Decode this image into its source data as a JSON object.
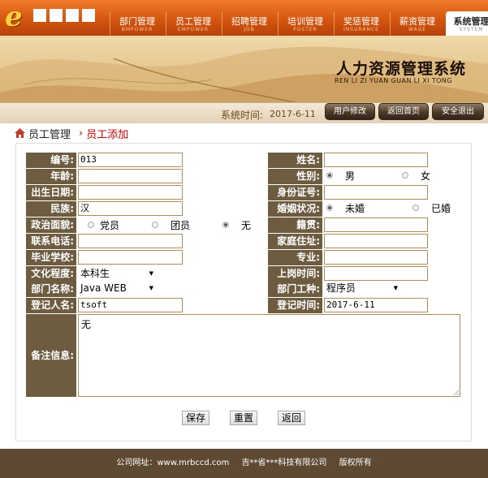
{
  "brand": {
    "logo_letter": "e",
    "name": ""
  },
  "nav": [
    {
      "zh": "部门管理",
      "en": "BMPOWER"
    },
    {
      "zh": "员工管理",
      "en": "EMPOWER"
    },
    {
      "zh": "招聘管理",
      "en": "JOB"
    },
    {
      "zh": "培训管理",
      "en": "FOSTER"
    },
    {
      "zh": "奖惩管理",
      "en": "INSURANCE"
    },
    {
      "zh": "薪资管理",
      "en": "WAGE"
    },
    {
      "zh": "系统管理",
      "en": "SYSTEM"
    }
  ],
  "header": {
    "system_title": "人力资源管理系统",
    "pinyin": "REN LI ZI YUAN GUAN LI XI TONG",
    "time_label": "系统时间:",
    "time_value": "2017-6-11",
    "buttons": [
      "用户修改",
      "返回首页",
      "安全退出"
    ]
  },
  "breadcrumb": {
    "current": "员工管理",
    "sub": "员工添加"
  },
  "form": {
    "number": {
      "label": "编号:",
      "value": "013"
    },
    "name": {
      "label": "姓名:",
      "value": ""
    },
    "age": {
      "label": "年龄:",
      "value": ""
    },
    "gender": {
      "label": "性别:",
      "options": [
        "男",
        "女"
      ],
      "selected": "男"
    },
    "birthday": {
      "label": "出生日期:",
      "value": ""
    },
    "id_card": {
      "label": "身份证号:",
      "value": ""
    },
    "nation": {
      "label": "民族:",
      "value": "汉"
    },
    "marriage": {
      "label": "婚姻状况:",
      "options": [
        "未婚",
        "已婚"
      ],
      "selected": "未婚"
    },
    "politics": {
      "label": "政治面貌:",
      "options": [
        "党员",
        "团员",
        "无"
      ],
      "selected": "无"
    },
    "native": {
      "label": "籍贯:",
      "value": ""
    },
    "phone": {
      "label": "联系电话:",
      "value": ""
    },
    "address": {
      "label": "家庭住址:",
      "value": ""
    },
    "school": {
      "label": "毕业学校:",
      "value": ""
    },
    "major": {
      "label": "专业:",
      "value": ""
    },
    "education": {
      "label": "文化程度:",
      "value": "本科生"
    },
    "hire_date": {
      "label": "上岗时间:",
      "value": ""
    },
    "dept": {
      "label": "部门名称:",
      "value": "Java WEB"
    },
    "job": {
      "label": "部门工种:",
      "value": "程序员"
    },
    "recorder": {
      "label": "登记人名:",
      "value": "tsoft"
    },
    "record_time": {
      "label": "登记时间:",
      "value": "2017-6-11"
    },
    "remark": {
      "label": "备注信息:",
      "value": "无"
    }
  },
  "actions": {
    "save": "保存",
    "reset": "重置",
    "back": "返回"
  },
  "footer": {
    "site": "公司网址：www.mrbccd.com",
    "company": "吉**省***科技有限公司",
    "rights": "版权所有"
  },
  "colors": {
    "accent": "#d4560f",
    "label_bg": "#6e5c40",
    "footer_bg": "#5e4a32"
  }
}
